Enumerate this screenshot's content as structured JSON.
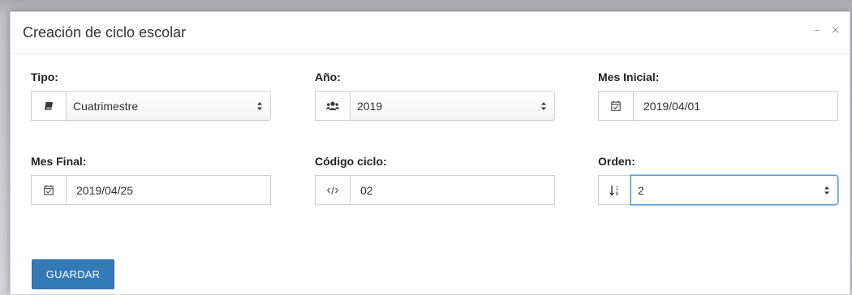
{
  "window": {
    "title": "Creación de ciclo escolar",
    "minimize_glyph": "–",
    "close_glyph": "×"
  },
  "form": {
    "tipo": {
      "label": "Tipo:",
      "value": "Cuatrimestre",
      "icon": "book-icon"
    },
    "anio": {
      "label": "Año:",
      "value": "2019",
      "icon": "users-icon"
    },
    "mes_inicial": {
      "label": "Mes Inicial:",
      "value": "2019/04/01",
      "icon": "calendar-check-icon"
    },
    "mes_final": {
      "label": "Mes Final:",
      "value": "2019/04/25",
      "icon": "calendar-check-icon"
    },
    "codigo_ciclo": {
      "label": "Código ciclo:",
      "value": "02",
      "icon": "code-icon"
    },
    "orden": {
      "label": "Orden:",
      "value": "2",
      "icon": "sort-numeric-icon"
    }
  },
  "actions": {
    "save_label": "GUARDAR"
  },
  "colors": {
    "primary": "#337ab7",
    "focus_border": "#5b9bd5"
  }
}
